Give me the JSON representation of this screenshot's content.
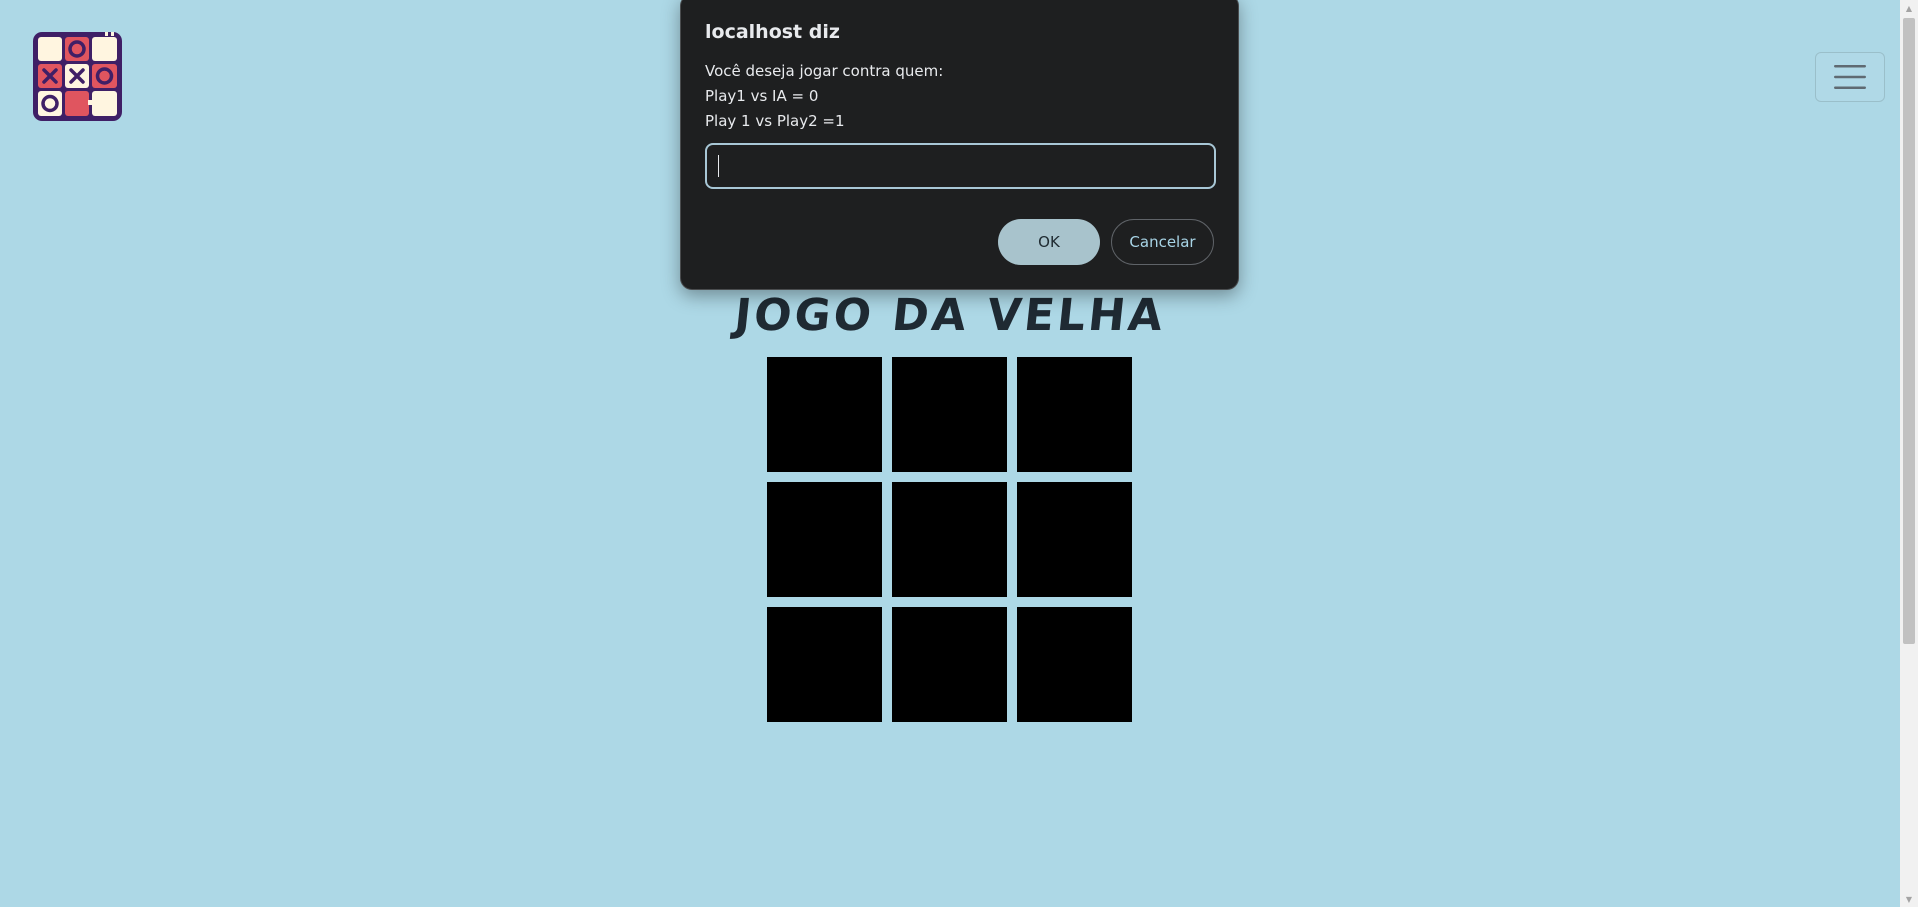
{
  "logo": {
    "icon": "tic-tac-toe-logo-icon",
    "colors": {
      "outline": "#3f1f66",
      "cream": "#fff5e0",
      "red": "#e0555f"
    }
  },
  "header": {
    "menu_icon": "hamburger-menu-icon"
  },
  "game": {
    "title": "JOGO DA VELHA",
    "cells": [
      "",
      "",
      "",
      "",
      "",
      "",
      "",
      "",
      ""
    ]
  },
  "dialog": {
    "title": "localhost diz",
    "message_lines": [
      "Você deseja jogar contra quem:",
      "Play1 vs IA = 0",
      "Play 1 vs Play2 =1"
    ],
    "input_value": "",
    "ok_label": "OK",
    "cancel_label": "Cancelar"
  },
  "colors": {
    "background": "#add8e6",
    "cell": "#000000",
    "dialog_bg": "#1e1f20",
    "ok_button": "#a8c3cc"
  }
}
